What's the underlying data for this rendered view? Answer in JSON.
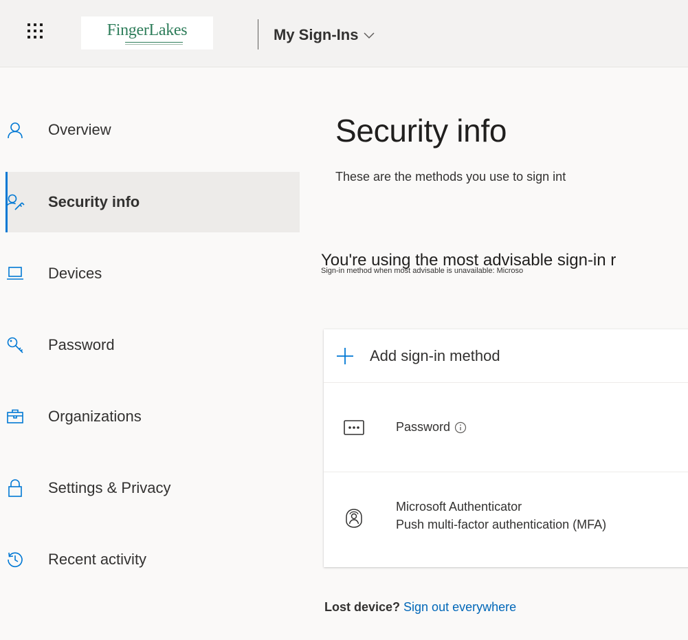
{
  "header": {
    "logo_text": "FingerLakes",
    "app_title": "My Sign-Ins"
  },
  "sidebar": {
    "items": [
      {
        "label": "Overview",
        "icon": "person-icon",
        "active": false
      },
      {
        "label": "Security info",
        "icon": "person-key-icon",
        "active": true
      },
      {
        "label": "Devices",
        "icon": "laptop-icon",
        "active": false
      },
      {
        "label": "Password",
        "icon": "key-icon",
        "active": false
      },
      {
        "label": "Organizations",
        "icon": "briefcase-icon",
        "active": false
      },
      {
        "label": "Settings & Privacy",
        "icon": "lock-icon",
        "active": false
      },
      {
        "label": "Recent activity",
        "icon": "history-icon",
        "active": false
      }
    ]
  },
  "main": {
    "title": "Security info",
    "description": "These are the methods you use to sign int",
    "advisable_title": "You're using the most advisable sign-in r",
    "advisable_subtitle": "Sign-in method when most advisable is unavailable: Microso",
    "add_method_label": "Add sign-in method",
    "methods": [
      {
        "name": "Password",
        "detail": "",
        "icon": "password-dots-icon"
      },
      {
        "name": "Microsoft Authenticator",
        "detail": "Push multi-factor authentication (MFA)",
        "icon": "authenticator-icon"
      }
    ],
    "lost_device_question": "Lost device?",
    "lost_device_link": "Sign out everywhere"
  },
  "colors": {
    "accent": "#0078d4",
    "link": "#0067b8",
    "logo_green": "#2e7d5a",
    "sidebar_active_bg": "#edebe9"
  }
}
